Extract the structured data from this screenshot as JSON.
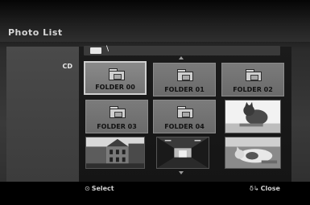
{
  "window": {
    "title": "Photo List"
  },
  "left_panel": {
    "source_label": "CD"
  },
  "path": {
    "icon": "disc-icon",
    "text": "\\"
  },
  "grid": {
    "folders": [
      {
        "label": "FOLDER 00",
        "selected": true
      },
      {
        "label": "FOLDER 01",
        "selected": false
      },
      {
        "label": "FOLDER 02",
        "selected": false
      },
      {
        "label": "FOLDER 03",
        "selected": false
      },
      {
        "label": "FOLDER 04",
        "selected": false
      }
    ],
    "photos": [
      {
        "name": "cat-photo"
      },
      {
        "name": "building-photo"
      },
      {
        "name": "corridor-photo"
      },
      {
        "name": "cat-lying-photo"
      }
    ]
  },
  "footer": {
    "select_glyph": "⊙",
    "select_label": "Select",
    "close_glyph": "δ↳",
    "close_label": "Close"
  }
}
